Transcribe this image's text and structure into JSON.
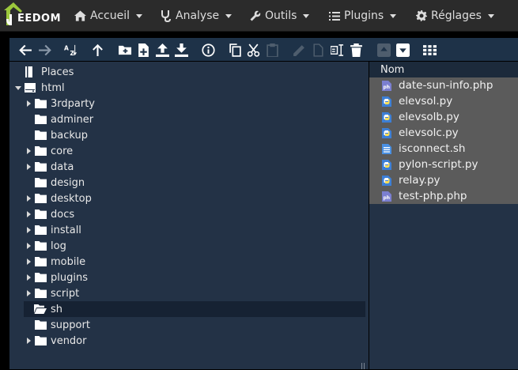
{
  "navbar": {
    "logo_text": "EEDOM",
    "items": [
      {
        "label": "Accueil",
        "icon": "home-icon"
      },
      {
        "label": "Analyse",
        "icon": "stethoscope-icon"
      },
      {
        "label": "Outils",
        "icon": "wrench-icon"
      },
      {
        "label": "Plugins",
        "icon": "list-icon"
      },
      {
        "label": "Réglages",
        "icon": "gear-icon"
      }
    ]
  },
  "toolbar": {
    "buttons": [
      {
        "icon": "back-arrow-icon",
        "enabled": true
      },
      {
        "icon": "forward-arrow-icon",
        "enabled": true
      },
      {
        "icon": "sort-az-icon",
        "enabled": true
      },
      {
        "icon": "up-arrow-icon",
        "enabled": true
      },
      {
        "icon": "new-folder-icon",
        "enabled": true
      },
      {
        "icon": "new-file-icon",
        "enabled": true
      },
      {
        "icon": "upload-icon",
        "enabled": true
      },
      {
        "icon": "download-icon",
        "enabled": true
      },
      {
        "icon": "info-icon",
        "enabled": true
      },
      {
        "icon": "copy-icon",
        "enabled": true
      },
      {
        "icon": "cut-icon",
        "enabled": true
      },
      {
        "icon": "paste-icon",
        "enabled": false
      },
      {
        "icon": "edit-icon",
        "enabled": false
      },
      {
        "icon": "duplicate-icon",
        "enabled": false
      },
      {
        "icon": "rename-icon",
        "enabled": true
      },
      {
        "icon": "delete-icon",
        "enabled": true
      },
      {
        "icon": "extract-icon",
        "enabled": false
      },
      {
        "icon": "archive-icon",
        "enabled": true
      },
      {
        "icon": "grid-view-icon",
        "enabled": true
      }
    ]
  },
  "tree": {
    "places_label": "Places",
    "root_label": "html",
    "folders": [
      {
        "name": "3rdparty",
        "expandable": true
      },
      {
        "name": "adminer",
        "expandable": false
      },
      {
        "name": "backup",
        "expandable": false
      },
      {
        "name": "core",
        "expandable": true
      },
      {
        "name": "data",
        "expandable": true
      },
      {
        "name": "design",
        "expandable": false
      },
      {
        "name": "desktop",
        "expandable": true
      },
      {
        "name": "docs",
        "expandable": true
      },
      {
        "name": "install",
        "expandable": true
      },
      {
        "name": "log",
        "expandable": true
      },
      {
        "name": "mobile",
        "expandable": true
      },
      {
        "name": "plugins",
        "expandable": true
      },
      {
        "name": "script",
        "expandable": true
      },
      {
        "name": "sh",
        "expandable": false,
        "selected": true
      },
      {
        "name": "support",
        "expandable": false
      },
      {
        "name": "vendor",
        "expandable": true
      }
    ]
  },
  "files": {
    "column_header": "Nom",
    "items": [
      {
        "name": "date-sun-info.php",
        "type": "php"
      },
      {
        "name": "elevsol.py",
        "type": "py"
      },
      {
        "name": "elevsolb.py",
        "type": "py"
      },
      {
        "name": "elevsolc.py",
        "type": "py"
      },
      {
        "name": "isconnect.sh",
        "type": "sh"
      },
      {
        "name": "pylon-script.py",
        "type": "py"
      },
      {
        "name": "relay.py",
        "type": "py"
      },
      {
        "name": "test-php.php",
        "type": "php"
      }
    ]
  },
  "colors": {
    "navbar": "#2b2b2b",
    "toolbar": "#1e3248",
    "panel": "#233246",
    "file_list_bg": "#5b5b5b",
    "selected_row": "#162233"
  }
}
